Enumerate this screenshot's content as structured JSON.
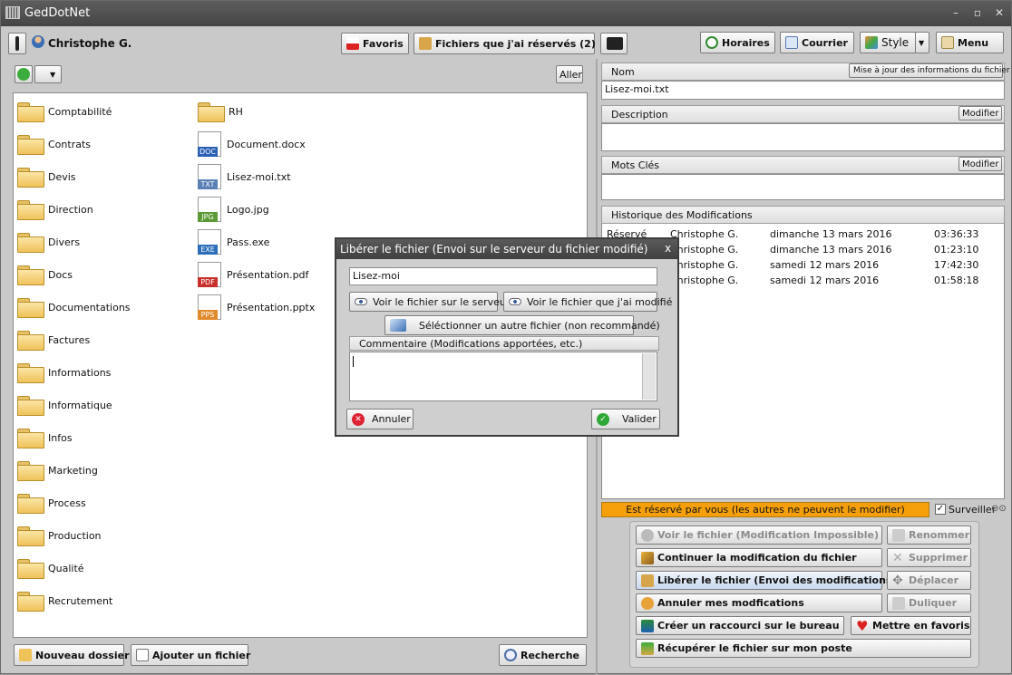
{
  "window": {
    "title": "GedDotNet"
  },
  "toolbar": {
    "user": "Christophe G.",
    "favoris": "Favoris",
    "reserved_files": "Fichiers que j'ai réservés (2)",
    "horaires": "Horaires",
    "courrier": "Courrier",
    "style": "Style",
    "menu": "Menu"
  },
  "left": {
    "aller": "Aller",
    "folders": [
      "Comptabilité",
      "Contrats",
      "Devis",
      "Direction",
      "Divers",
      "Docs",
      "Documentations",
      "Factures",
      "Informations",
      "Informatique",
      "Infos",
      "Marketing",
      "Process",
      "Production",
      "Qualité",
      "Recrutement"
    ],
    "col2": [
      {
        "name": "RH",
        "kind": "folder"
      },
      {
        "name": "Document.docx",
        "kind": "DOC",
        "color": "#2b5fb4"
      },
      {
        "name": "Lisez-moi.txt",
        "kind": "TXT",
        "color": "#5a7fb5"
      },
      {
        "name": "Logo.jpg",
        "kind": "JPG",
        "color": "#5b9a34"
      },
      {
        "name": "Pass.exe",
        "kind": "EXE",
        "color": "#2c6fb8"
      },
      {
        "name": "Présentation.pdf",
        "kind": "PDF",
        "color": "#c9302c"
      },
      {
        "name": "Présentation.pptx",
        "kind": "PPS",
        "color": "#e08a2c"
      }
    ],
    "new_folder": "Nouveau dossier",
    "add_file": "Ajouter un fichier",
    "search": "Recherche"
  },
  "right": {
    "nom_label": "Nom",
    "update_info": "Mise à jour des informations du fichier",
    "nom_value": "Lisez-moi.txt",
    "description_label": "Description",
    "modifier": "Modifier",
    "mots_cles_label": "Mots Clés",
    "history_label": "Historique des Modifications",
    "history": [
      {
        "action": "Réservé",
        "user": "Christophe G.",
        "date": "dimanche 13 mars 2016",
        "time": "03:36:33"
      },
      {
        "action": "",
        "user": "Christophe G.",
        "date": "dimanche 13 mars 2016",
        "time": "01:23:10"
      },
      {
        "action": "",
        "user": "Christophe G.",
        "date": "samedi 12 mars 2016",
        "time": "17:42:30"
      },
      {
        "action": "",
        "user": "Christophe G.",
        "date": "samedi 12 mars 2016",
        "time": "01:58:18"
      }
    ],
    "status": "Est réservé par vous (les autres ne peuvent le modifier)",
    "surveiller": "Surveiller",
    "actions": {
      "view": "Voir le fichier (Modification Impossible)",
      "rename": "Renommer",
      "continue": "Continuer la modification du fichier",
      "delete": "Supprimer",
      "release": "Libérer le fichier (Envoi des modifications)",
      "move": "Déplacer",
      "cancel": "Annuler mes modfications",
      "duplicate": "Duliquer",
      "shortcut": "Créer un raccourci sur le bureau",
      "favorite": "Mettre en favoris",
      "download": "Récupérer le fichier sur mon poste"
    }
  },
  "dialog": {
    "title": "Libérer le fichier (Envoi sur le serveur du fichier modifié)",
    "close": "x",
    "file_name": "Lisez-moi",
    "view_server": "Voir le fichier sur le serveur",
    "view_modified": "Voir le fichier que j'ai modifié",
    "select_other": "Séléctionner un autre fichier (non recommandé)",
    "comment_label": "Commentaire (Modifications apportées, etc.)",
    "cancel": "Annuler",
    "validate": "Valider"
  },
  "colors": {
    "status_bg": "#f5a00a",
    "titlebar": "#4e4e4e"
  }
}
